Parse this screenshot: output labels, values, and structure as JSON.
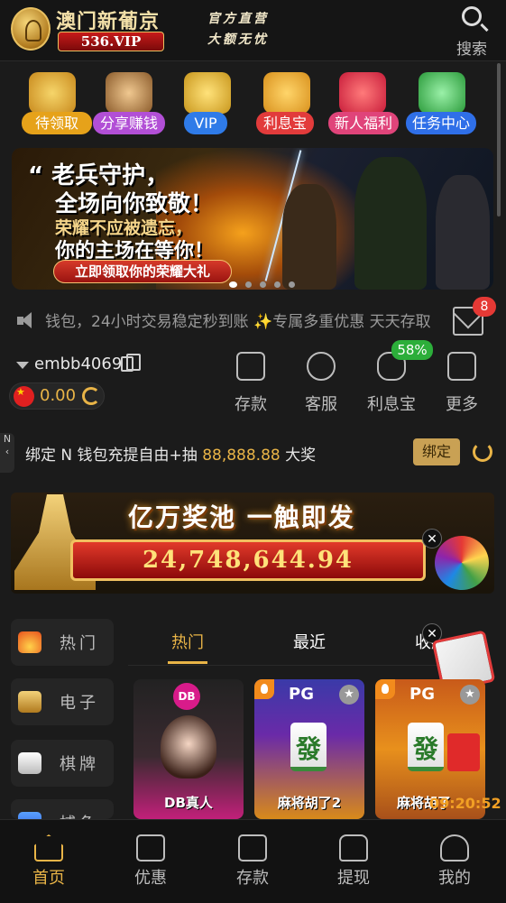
{
  "header": {
    "logo_title": "澳门新葡京",
    "logo_domain": "536.VIP",
    "slogan_line1": "官方直营",
    "slogan_line2": "大额无忧",
    "search_label": "搜索"
  },
  "quick_links": [
    {
      "label": "待领取",
      "icon": "gold-coins-hand-icon",
      "color": "#e6a21a"
    },
    {
      "label": "分享赚钱",
      "icon": "people-group-icon",
      "color": "#b24fd6"
    },
    {
      "label": "VIP",
      "icon": "vip-crown-icon",
      "color": "#2f7be8"
    },
    {
      "label": "利息宝",
      "icon": "piggy-bank-icon",
      "color": "#e23b3b"
    },
    {
      "label": "新人福利",
      "icon": "gift-box-icon",
      "color": "#e0447a"
    },
    {
      "label": "任务中心",
      "icon": "task-checklist-icon",
      "color": "#2f6fe8"
    }
  ],
  "banner": {
    "line1": "老兵守护，",
    "line2": "全场向你致敬！",
    "line3": "荣耀不应被遗忘，",
    "line4": "你的主场在等你！",
    "cta": "立即领取你的荣耀大礼",
    "slides": 5,
    "active_slide": 1
  },
  "marquee": {
    "text": "钱包，24小时交易稳定秒到账 ✨专属多重优惠 天天存取"
  },
  "messages": {
    "unread": "8"
  },
  "account": {
    "username": "embb4069",
    "balance": "0.00"
  },
  "actions": [
    {
      "label": "存款",
      "icon": "wallet-icon"
    },
    {
      "label": "客服",
      "icon": "headset-icon"
    },
    {
      "label": "利息宝",
      "icon": "piggy-bank-icon",
      "badge": "58%"
    },
    {
      "label": "更多",
      "icon": "grid-more-icon"
    }
  ],
  "bind_bar": {
    "side_tab": "N",
    "text_before": "绑定 N",
    "text_mid": " 钱包充提自由+抽 ",
    "amount": "88,888.88",
    "text_after": " 大奖",
    "button": "绑定"
  },
  "jackpot": {
    "title": "亿万奖池  一触即发",
    "amount": "24,748,644.94"
  },
  "categories": [
    {
      "label": "热门",
      "icon": "flame-icon"
    },
    {
      "label": "电子",
      "icon": "slot-777-icon"
    },
    {
      "label": "棋牌",
      "icon": "playing-cards-icon"
    },
    {
      "label": "捕鱼",
      "icon": "fish-icon"
    }
  ],
  "tabs": [
    "热门",
    "最近",
    "收藏"
  ],
  "games": [
    {
      "label": "DB真人",
      "provider": "DB",
      "tile": ""
    },
    {
      "label": "麻将胡了2",
      "provider": "PG",
      "tile": "發"
    },
    {
      "label": "麻将胡了",
      "provider": "PG",
      "tile": "發"
    }
  ],
  "countdown": "09:20:52",
  "bottom_nav": [
    {
      "label": "首页",
      "icon": "home-icon"
    },
    {
      "label": "优惠",
      "icon": "gift-icon"
    },
    {
      "label": "存款",
      "icon": "wallet-icon"
    },
    {
      "label": "提现",
      "icon": "withdraw-card-icon"
    },
    {
      "label": "我的",
      "icon": "user-profile-icon"
    }
  ],
  "colors": {
    "accent_gold": "#e9b447",
    "background": "#1b1b1b",
    "badge_red": "#e53935",
    "badge_green": "#2cae3a"
  }
}
